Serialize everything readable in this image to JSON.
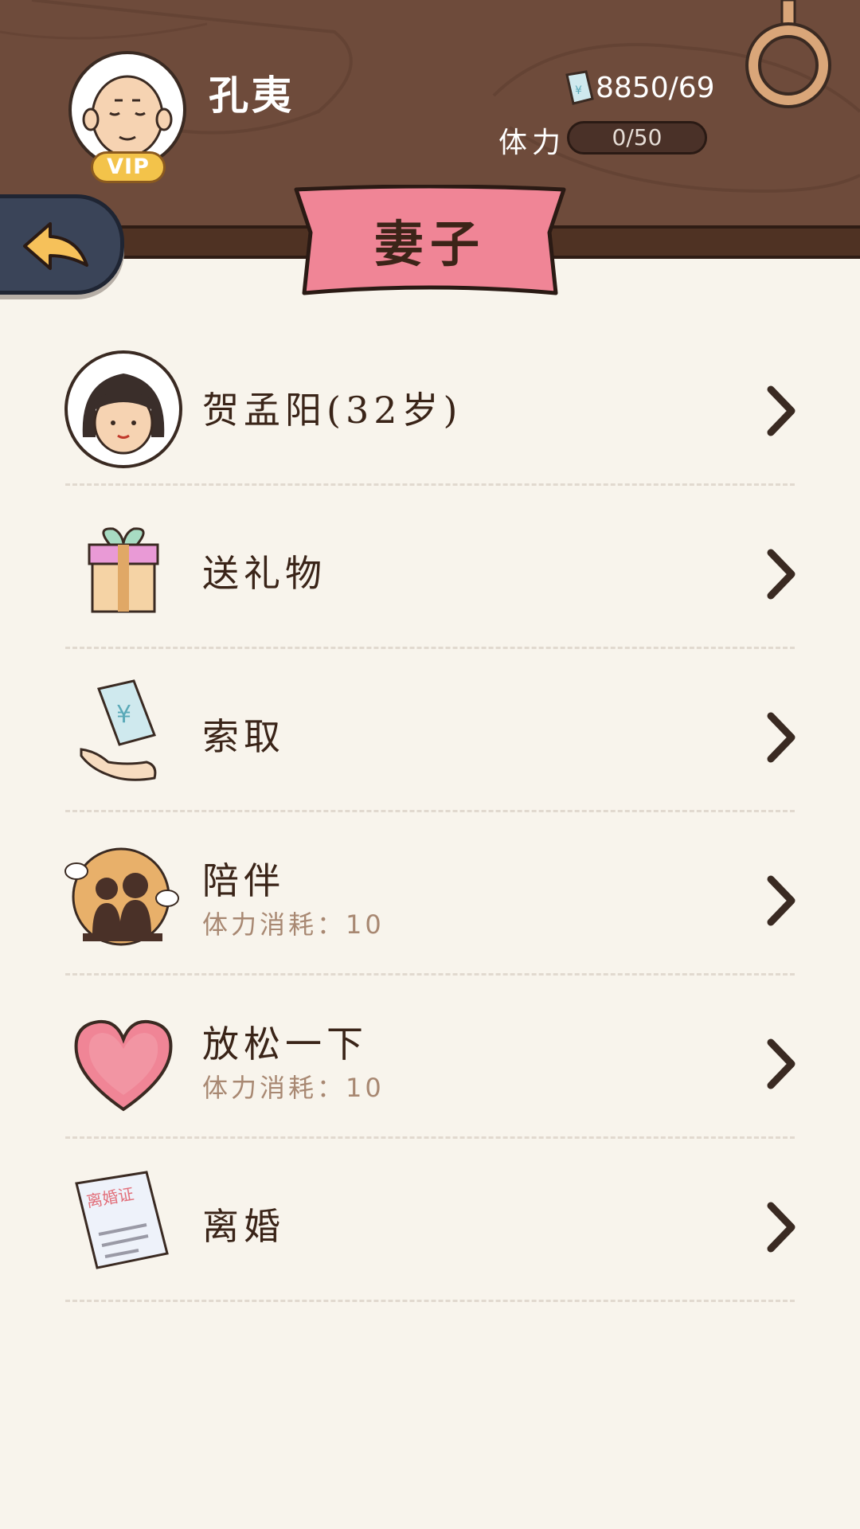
{
  "player": {
    "name": "孔夷",
    "vip_label": "VIP",
    "money": "8850/69",
    "stamina_label": "体力",
    "stamina_value": "0/50"
  },
  "page": {
    "title": "妻子"
  },
  "wife_row": {
    "label": "贺孟阳(32岁)"
  },
  "actions": [
    {
      "icon": "gift-icon",
      "label": "送礼物",
      "sub": ""
    },
    {
      "icon": "money-hand-icon",
      "label": "索取",
      "sub": ""
    },
    {
      "icon": "companion-icon",
      "label": "陪伴",
      "sub": "体力消耗：10"
    },
    {
      "icon": "heart-icon",
      "label": "放松一下",
      "sub": "体力消耗：10"
    },
    {
      "icon": "divorce-certificate-icon",
      "label": "离婚",
      "sub": "",
      "certificate_text": "离婚证"
    }
  ],
  "colors": {
    "header_wood": "#6e4b3b",
    "ribbon_pink": "#f08596",
    "background": "#f8f4ec",
    "back_button": "#3a4458",
    "back_arrow": "#f6c15a"
  }
}
